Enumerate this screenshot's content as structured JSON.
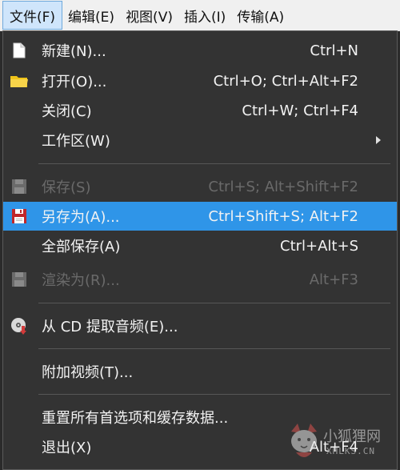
{
  "menubar": {
    "items": [
      {
        "label": "文件(F)",
        "active": true
      },
      {
        "label": "编辑(E)"
      },
      {
        "label": "视图(V)"
      },
      {
        "label": "插入(I)"
      },
      {
        "label": "传输(A)"
      }
    ]
  },
  "file_menu": {
    "items": [
      {
        "label": "新建(N)...",
        "shortcut": "Ctrl+N",
        "icon": "new-file-icon"
      },
      {
        "label": "打开(O)...",
        "shortcut": "Ctrl+O; Ctrl+Alt+F2",
        "icon": "folder-icon"
      },
      {
        "label": "关闭(C)",
        "shortcut": "Ctrl+W; Ctrl+F4"
      },
      {
        "label": "工作区(W)",
        "submenu": true
      },
      {
        "label": "保存(S)",
        "shortcut": "Ctrl+S; Alt+Shift+F2",
        "icon": "floppy-disk-icon",
        "disabled": true
      },
      {
        "label": "另存为(A)...",
        "shortcut": "Ctrl+Shift+S; Alt+F2",
        "icon": "floppy-disk-icon",
        "highlighted": true
      },
      {
        "label": "全部保存(A)",
        "shortcut": "Ctrl+Alt+S"
      },
      {
        "label": "渲染为(R)...",
        "shortcut": "Alt+F3",
        "icon": "floppy-disk-icon",
        "disabled": true
      },
      {
        "label": "从 CD 提取音频(E)...",
        "icon": "cd-extract-icon"
      },
      {
        "label": "附加视频(T)..."
      },
      {
        "label": "重置所有首选项和缓存数据..."
      },
      {
        "label": "退出(X)",
        "shortcut": "Alt+F4"
      }
    ]
  },
  "colors": {
    "menu_bg": "#333333",
    "highlight": "#2f95e8",
    "disabled_text": "#6a6a6a",
    "menubar_bg": "#f0f0f0",
    "active_menubar": "#cfe5fb"
  },
  "watermark": {
    "text": "小狐狸网",
    "sub": "XHLKS.CN"
  }
}
